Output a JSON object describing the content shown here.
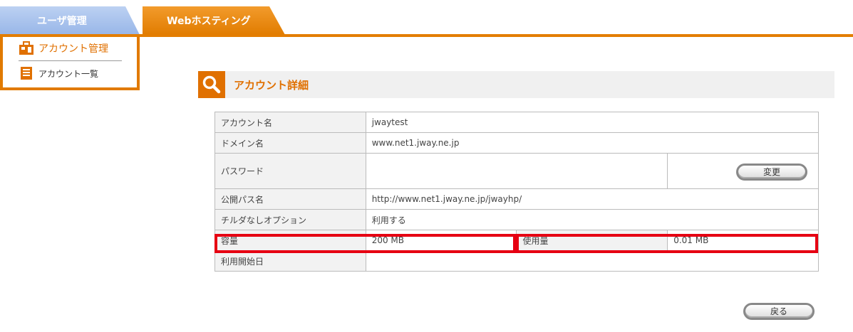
{
  "tabs": [
    {
      "label": "ユーザ管理"
    },
    {
      "label": "Webホスティング"
    }
  ],
  "sidebar": {
    "heading": "アカウント管理",
    "items": [
      {
        "label": "アカウント一覧"
      }
    ]
  },
  "main": {
    "title": "アカウント詳細",
    "rows": {
      "account_name": {
        "label": "アカウント名",
        "value": "jwaytest"
      },
      "domain": {
        "label": "ドメイン名",
        "value": "www.net1.jway.ne.jp"
      },
      "password": {
        "label": "パスワード",
        "value": "",
        "button": "変更"
      },
      "public_path": {
        "label": "公開パス名",
        "value": "http://www.net1.jway.ne.jp/jwayhp/"
      },
      "tilde": {
        "label": "チルダなしオプション",
        "value": "利用する"
      },
      "capacity": {
        "label": "容量",
        "value": "200 MB",
        "used_label": "使用量",
        "used_value": "0.01 MB"
      },
      "start_date": {
        "label": "利用開始日",
        "value": ""
      }
    },
    "back_button": "戻る"
  },
  "colors": {
    "accent": "#e37d00",
    "highlight": "#e60012",
    "tab_inactive": "#98b6e8"
  }
}
